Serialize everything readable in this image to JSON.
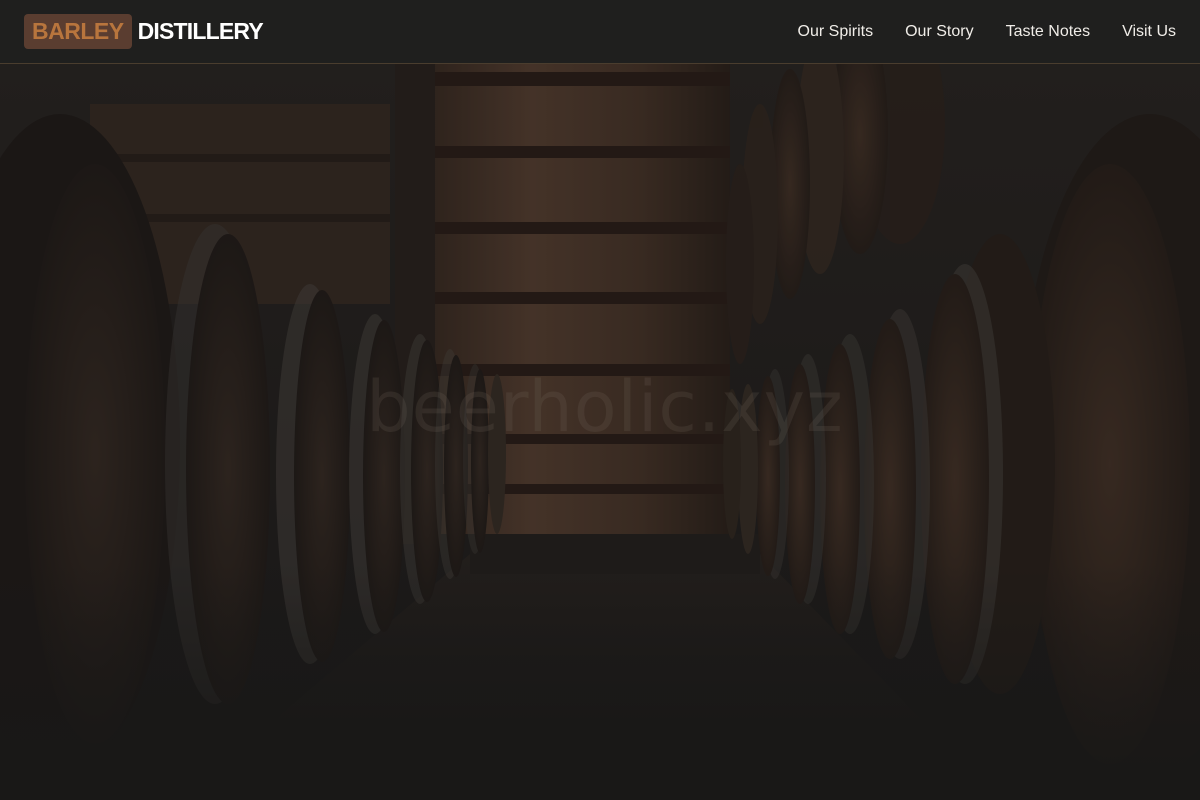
{
  "brand": {
    "highlight": "BARLEY",
    "rest": "DISTILLERY"
  },
  "nav": {
    "links": [
      {
        "label": "Our Spirits"
      },
      {
        "label": "Our Story"
      },
      {
        "label": "Taste Notes"
      },
      {
        "label": "Visit Us"
      }
    ]
  },
  "hero": {
    "image": "barrel-cellar-photo",
    "watermark": "beerholic.xyz"
  },
  "colors": {
    "nav_bg": "#1f1f1e",
    "brand_box_bg": "#5a3d30",
    "brand_highlight": "#b8753d",
    "brand_text": "#ffffff",
    "nav_text": "#f0ede8",
    "nav_border": "#4a3d2e"
  }
}
